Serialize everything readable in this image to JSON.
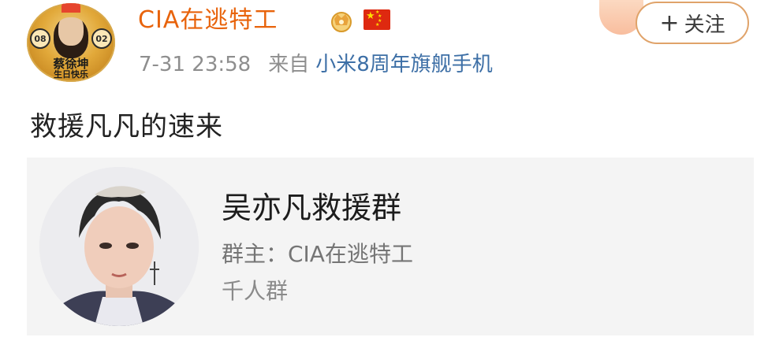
{
  "post": {
    "author": {
      "name": "CIA在逃特工",
      "avatar_badge_left": "08",
      "avatar_badge_right": "02",
      "avatar_caption_1": "蔡徐坤",
      "avatar_caption_2": "生日快乐"
    },
    "time": "7-31 23:58",
    "source_label": "来自",
    "device": "小米8周年旗舰手机",
    "follow_label": "关注",
    "follow_plus": "+",
    "text": "救援凡凡的速来"
  },
  "group_card": {
    "name": "吴亦凡救援群",
    "owner": "群主：CIA在逃特工",
    "size": "千人群"
  },
  "colors": {
    "author_name": "#e8630b",
    "device_link": "#3d6fa6",
    "follow_border": "#e0a36a",
    "card_bg": "#f4f4f4"
  },
  "icons": [
    "vip-crown-icon",
    "china-flag-icon",
    "plus-icon"
  ]
}
